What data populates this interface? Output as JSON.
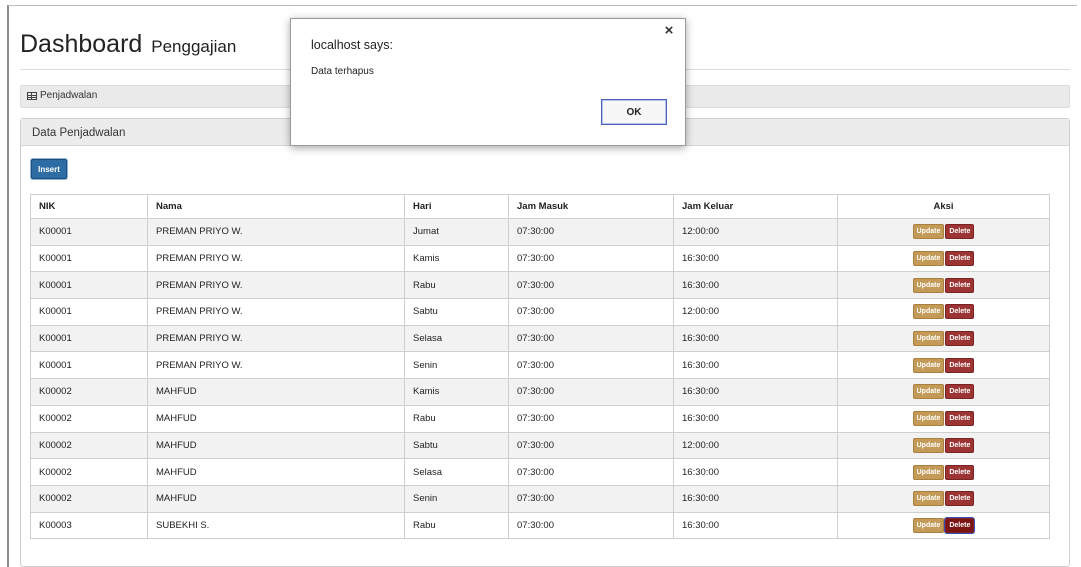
{
  "page": {
    "title": "Dashboard",
    "subtitle": "Penggajian"
  },
  "breadcrumb": {
    "icon": "table-icon",
    "label": "Penjadwalan"
  },
  "panel": {
    "heading": "Data Penjadwalan",
    "insert_label": "Insert"
  },
  "table": {
    "headers": [
      "NIK",
      "Nama",
      "Hari",
      "Jam Masuk",
      "Jam Keluar",
      "Aksi"
    ],
    "update_label": "Update",
    "delete_label": "Delete",
    "rows": [
      {
        "nik": "K00001",
        "nama": "PREMAN PRIYO W.",
        "hari": "Jumat",
        "masuk": "07:30:00",
        "keluar": "12:00:00"
      },
      {
        "nik": "K00001",
        "nama": "PREMAN PRIYO W.",
        "hari": "Kamis",
        "masuk": "07:30:00",
        "keluar": "16:30:00"
      },
      {
        "nik": "K00001",
        "nama": "PREMAN PRIYO W.",
        "hari": "Rabu",
        "masuk": "07:30:00",
        "keluar": "16:30:00"
      },
      {
        "nik": "K00001",
        "nama": "PREMAN PRIYO W.",
        "hari": "Sabtu",
        "masuk": "07:30:00",
        "keluar": "12:00:00"
      },
      {
        "nik": "K00001",
        "nama": "PREMAN PRIYO W.",
        "hari": "Selasa",
        "masuk": "07:30:00",
        "keluar": "16:30:00"
      },
      {
        "nik": "K00001",
        "nama": "PREMAN PRIYO W.",
        "hari": "Senin",
        "masuk": "07:30:00",
        "keluar": "16:30:00"
      },
      {
        "nik": "K00002",
        "nama": "MAHFUD",
        "hari": "Kamis",
        "masuk": "07:30:00",
        "keluar": "16:30:00"
      },
      {
        "nik": "K00002",
        "nama": "MAHFUD",
        "hari": "Rabu",
        "masuk": "07:30:00",
        "keluar": "16:30:00"
      },
      {
        "nik": "K00002",
        "nama": "MAHFUD",
        "hari": "Sabtu",
        "masuk": "07:30:00",
        "keluar": "12:00:00"
      },
      {
        "nik": "K00002",
        "nama": "MAHFUD",
        "hari": "Selasa",
        "masuk": "07:30:00",
        "keluar": "16:30:00"
      },
      {
        "nik": "K00002",
        "nama": "MAHFUD",
        "hari": "Senin",
        "masuk": "07:30:00",
        "keluar": "16:30:00"
      },
      {
        "nik": "K00003",
        "nama": "SUBEKHI S.",
        "hari": "Rabu",
        "masuk": "07:30:00",
        "keluar": "16:30:00"
      }
    ]
  },
  "dialog": {
    "title": "localhost says:",
    "message": "Data terhapus",
    "ok_label": "OK",
    "close_icon": "close-icon"
  },
  "colors": {
    "insert_button": "#2e6da4",
    "update_button": "#c49a58",
    "delete_button": "#9c3434",
    "dialog_focus_border": "#4a5fb8"
  }
}
